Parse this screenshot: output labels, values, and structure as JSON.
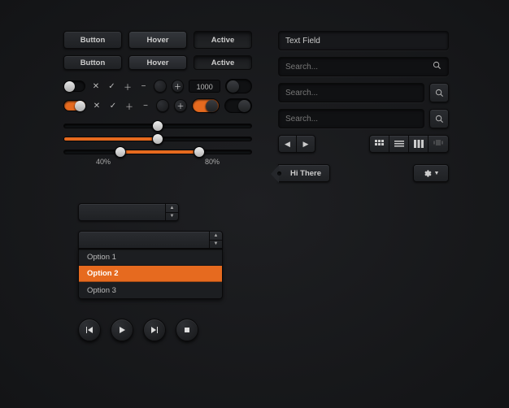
{
  "accent": "#e66a1f",
  "buttons": {
    "row1": [
      "Button",
      "Hover",
      "Active"
    ],
    "row2": [
      "Button",
      "Hover",
      "Active"
    ]
  },
  "controls": {
    "stepper_value": "1000",
    "slider_scale": {
      "a": "40%",
      "b": "80%"
    }
  },
  "right": {
    "textfield_label": "Text Field",
    "search_placeholder": "Search...",
    "tag_label": "Hi There"
  },
  "dropdown": {
    "options": [
      "Option 1",
      "Option 2",
      "Option 3"
    ],
    "selected_index": 1
  },
  "icons": {
    "close": "close-icon",
    "check": "check-icon",
    "plus": "plus-icon",
    "minus": "minus-icon",
    "search": "search-icon",
    "gear": "gear-icon",
    "chevron-down": "chevron-down-icon",
    "prev": "prev-icon",
    "play": "play-icon",
    "next": "next-icon",
    "stop": "stop-icon",
    "grid": "grid-view-icon",
    "list": "list-view-icon",
    "column": "column-view-icon",
    "cover": "coverflow-view-icon",
    "left": "triangle-left-icon",
    "right": "triangle-right-icon"
  }
}
